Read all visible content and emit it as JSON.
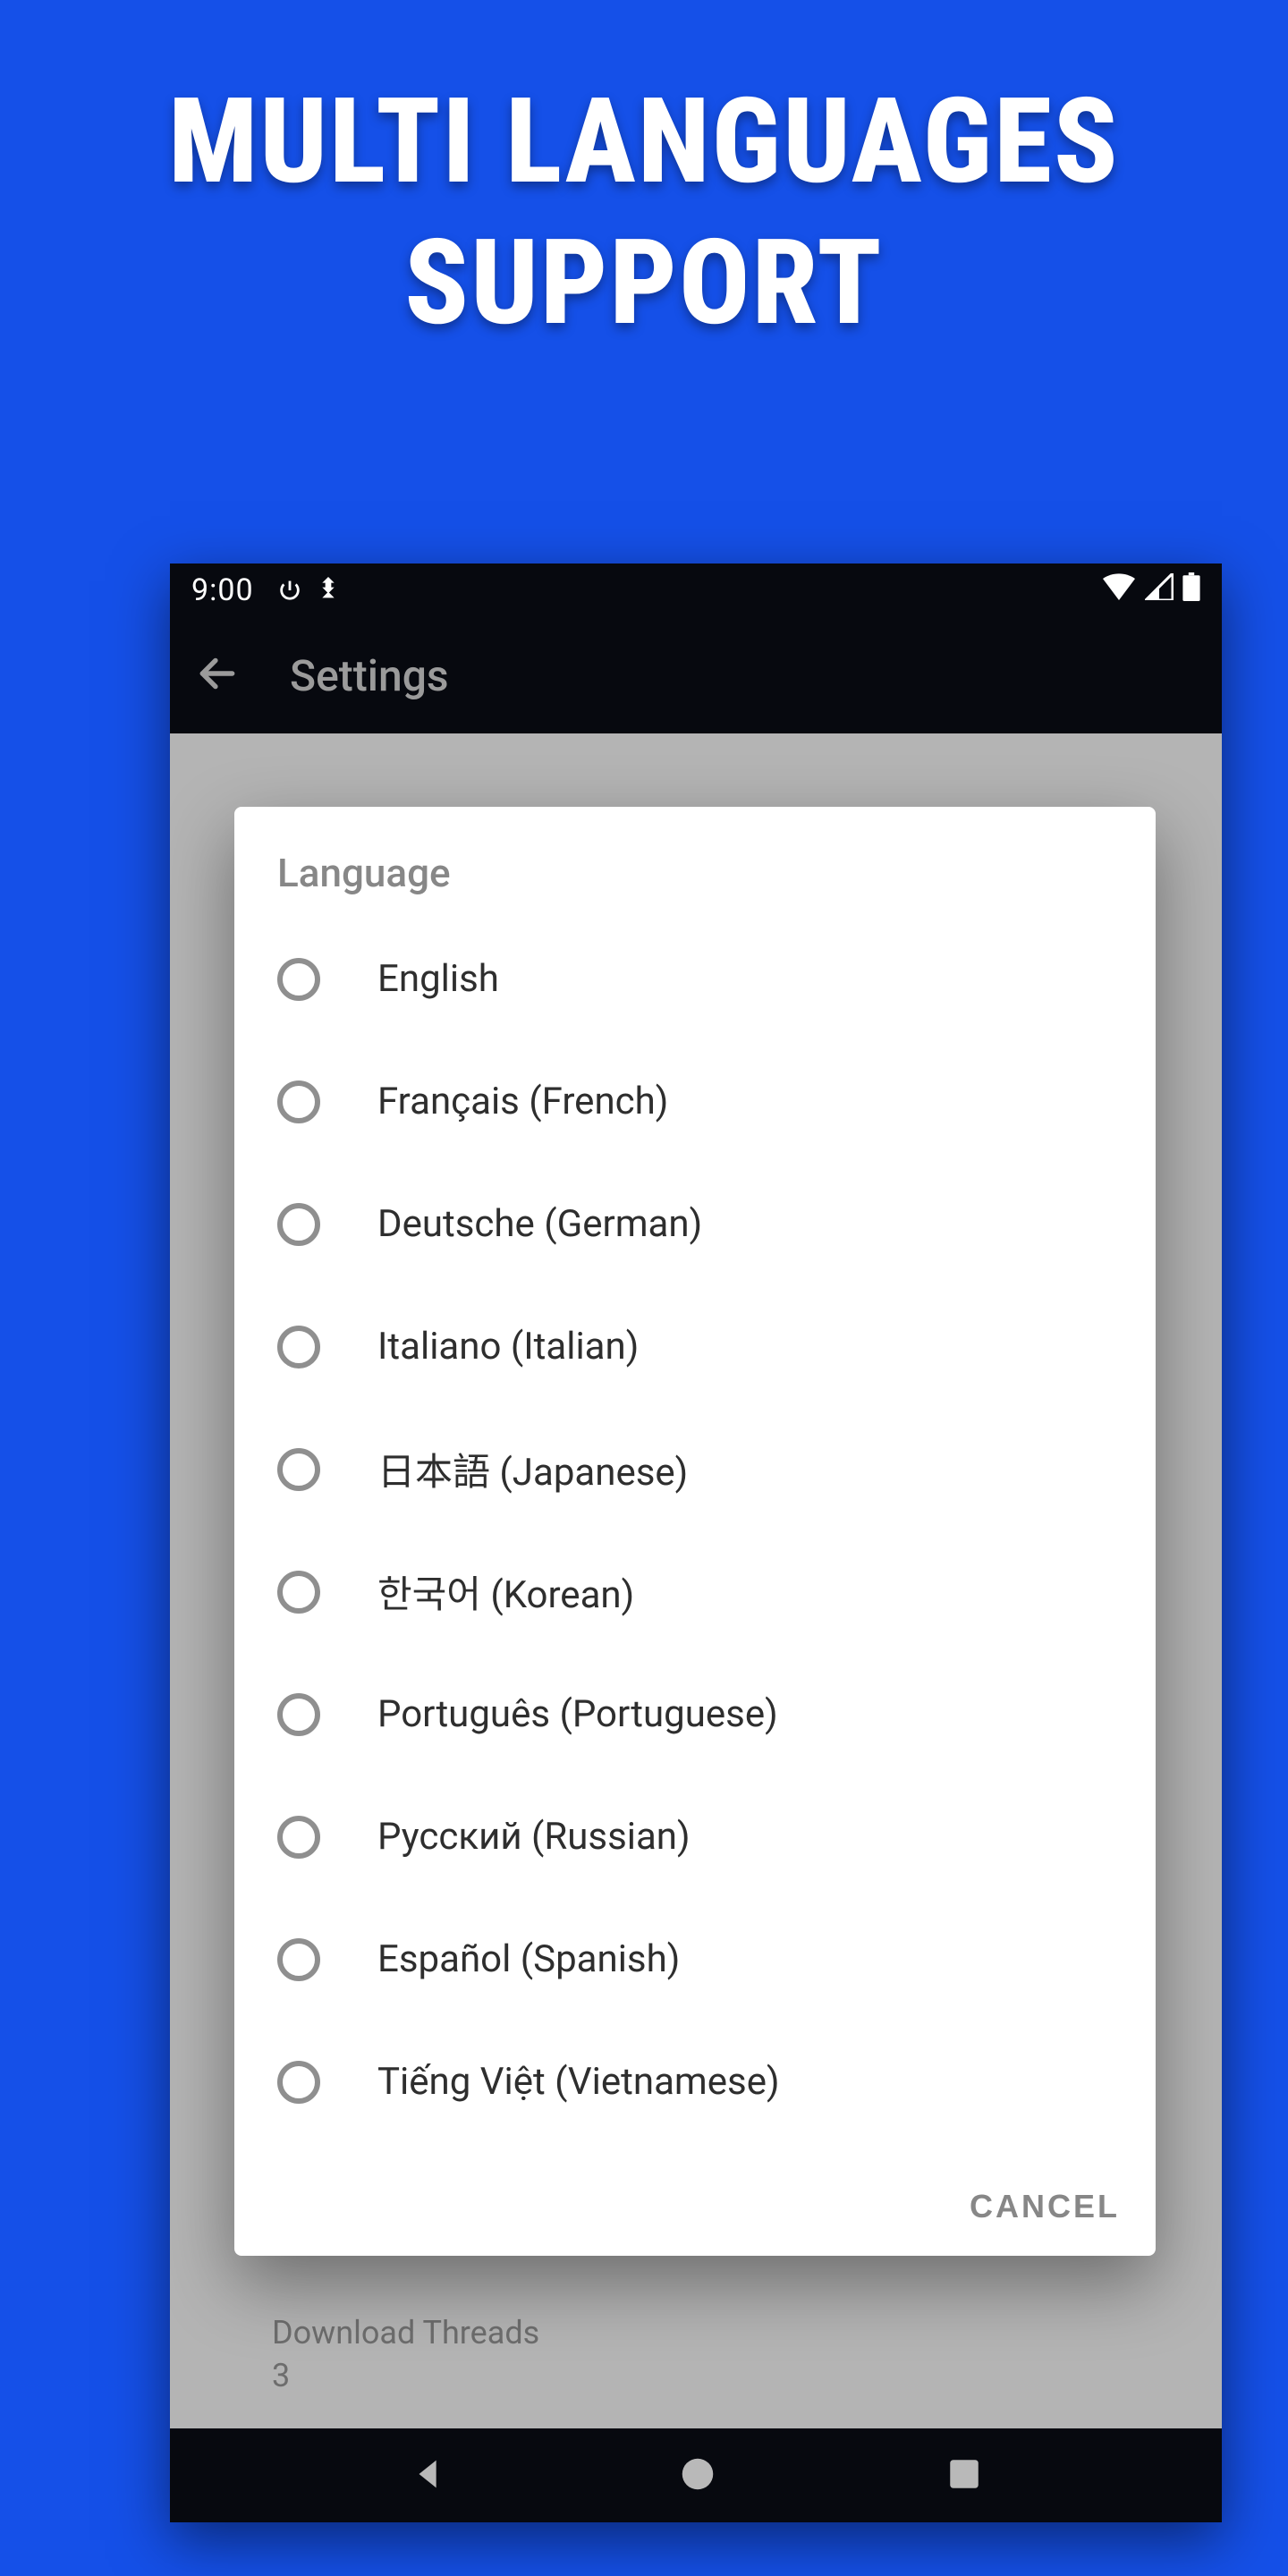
{
  "promo": {
    "line1": "MULTI LANGUAGES",
    "line2": "SUPPORT"
  },
  "statusbar": {
    "time": "9:00"
  },
  "appbar": {
    "title": "Settings"
  },
  "dialog": {
    "title": "Language",
    "options": [
      {
        "label": "English"
      },
      {
        "label": "Français (French)"
      },
      {
        "label": "Deutsche (German)"
      },
      {
        "label": "Italiano (Italian)"
      },
      {
        "label": "日本語 (Japanese)"
      },
      {
        "label": "한국어 (Korean)"
      },
      {
        "label": "Português (Portuguese)"
      },
      {
        "label": "Русский (Russian)"
      },
      {
        "label": "Español (Spanish)"
      },
      {
        "label": "Tiếng Việt (Vietnamese)"
      }
    ],
    "cancel": "CANCEL"
  },
  "backdrop": {
    "threads_label": "Download Threads",
    "threads_value": "3"
  }
}
